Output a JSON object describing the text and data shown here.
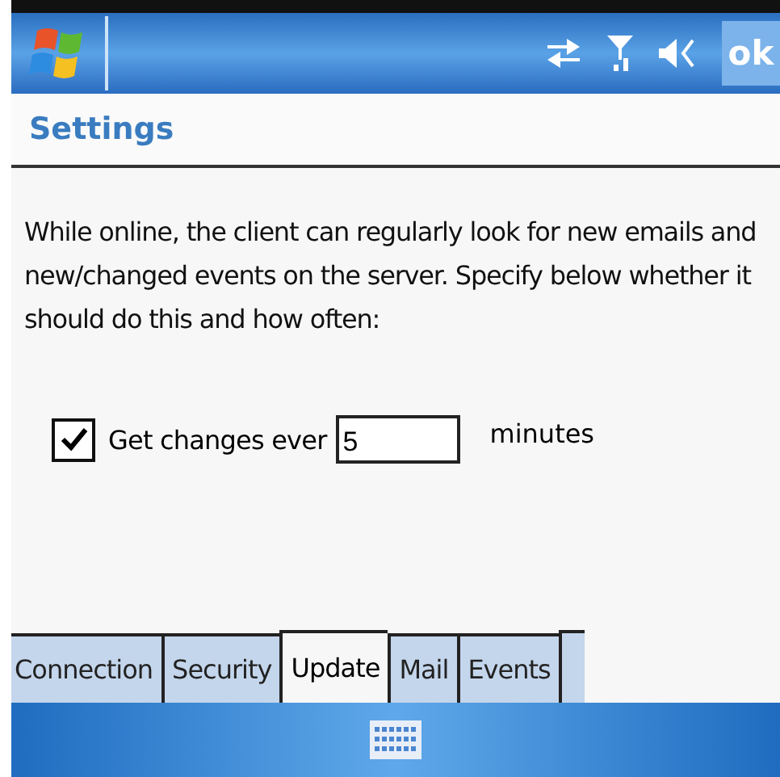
{
  "title_bar": {
    "ok_button": "ok"
  },
  "header": {
    "title": "Settings"
  },
  "description": "While online, the client can regularly look for new emails and new/changed events on the server. Specify below whether it should do this and how often:",
  "interval": {
    "label": "Get changes ever",
    "checked": true,
    "value": "5",
    "unit": "minutes"
  },
  "tabs": [
    {
      "label": "Connection",
      "selected": false
    },
    {
      "label": "Security",
      "selected": false
    },
    {
      "label": "Update",
      "selected": true
    },
    {
      "label": "Mail",
      "selected": false
    },
    {
      "label": "Events",
      "selected": false
    }
  ]
}
